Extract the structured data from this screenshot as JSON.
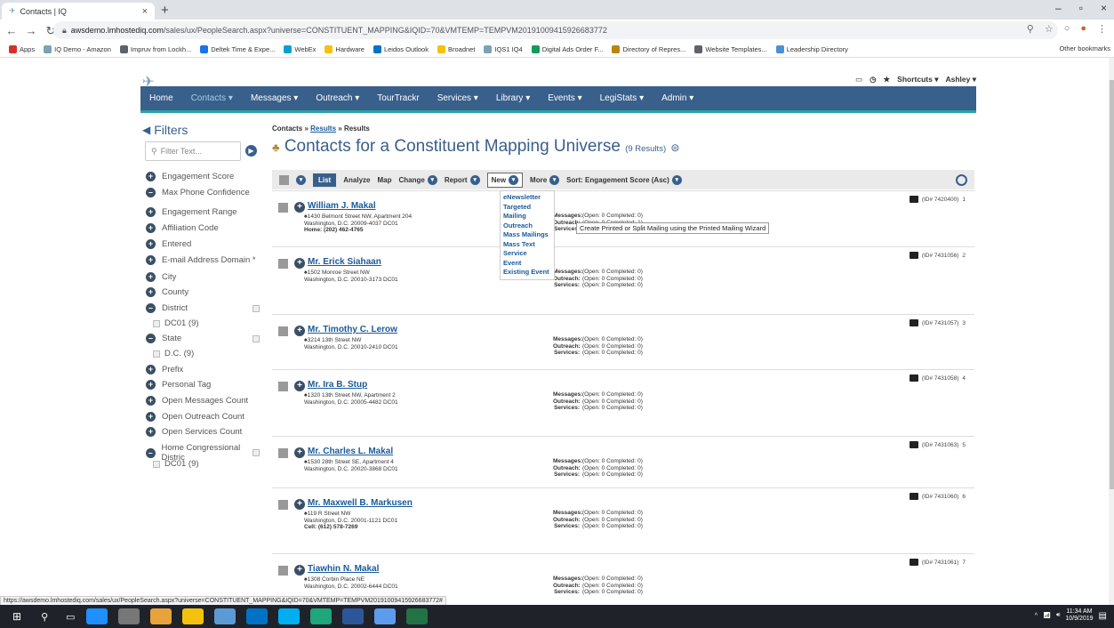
{
  "browser": {
    "tab_title": "Contacts | IQ",
    "tab_close": "×",
    "new_tab": "+",
    "url_host": "awsdemo.lmhostediq.com",
    "url_path": "/sales/ux/PeopleSearch.aspx?universe=CONSTITUENT_MAPPING&IQID=70&VMTEMP=TEMPVM20191009415926683772",
    "win_min": "–",
    "win_max": "▫",
    "win_close": "×",
    "bookmarks": [
      {
        "label": "Apps",
        "color": "#d93025"
      },
      {
        "label": "IQ Demo - Amazon",
        "color": "#7ca2b6"
      },
      {
        "label": "Impruv from Lockh...",
        "color": "#5f6368"
      },
      {
        "label": "Deltek Time & Expe...",
        "color": "#1a73e8"
      },
      {
        "label": "WebEx",
        "color": "#00a0d1"
      },
      {
        "label": "Hardware",
        "color": "#f4c20d"
      },
      {
        "label": "Leidos Outlook",
        "color": "#0072c6"
      },
      {
        "label": "Broadnet",
        "color": "#f4c20d"
      },
      {
        "label": "IQS1 IQ4",
        "color": "#7ca2b6"
      },
      {
        "label": "Digital Ads Order F...",
        "color": "#0f9d58"
      },
      {
        "label": "Directory of Repres...",
        "color": "#b8860b"
      },
      {
        "label": "Website Templates...",
        "color": "#5f6368"
      },
      {
        "label": "Leadership Directory",
        "color": "#4a90d9"
      }
    ],
    "other_bookmarks": "Other bookmarks",
    "status_url": "https://awsdemo.lmhostediq.com/sales/ux/PeopleSearch.aspx?universe=CONSTITUENT_MAPPING&IQID=70&VMTEMP=TEMPVM20191009415926683772#"
  },
  "header": {
    "shortcuts": "Shortcuts ▾",
    "user": "Ashley ▾"
  },
  "nav": [
    "Home",
    "Contacts ▾",
    "Messages ▾",
    "Outreach ▾",
    "TourTrackr",
    "Services ▾",
    "Library ▾",
    "Events ▾",
    "LegiStats ▾",
    "Admin ▾"
  ],
  "filters": {
    "title": "Filters",
    "placeholder": "Filter Text...",
    "items": [
      {
        "label": "Engagement Score",
        "type": "plus"
      },
      {
        "label": "Max Phone Confidence",
        "type": "minus"
      },
      {
        "label": "Engagement Range",
        "type": "plus"
      },
      {
        "label": "Affiliation Code",
        "type": "plus"
      },
      {
        "label": "Entered",
        "type": "plus"
      },
      {
        "label": "E-mail Address Domain *",
        "type": "plus"
      },
      {
        "label": "City",
        "type": "plus"
      },
      {
        "label": "County",
        "type": "plus"
      },
      {
        "label": "District",
        "type": "minus"
      },
      {
        "label": "DC01 (9)",
        "type": "sub"
      },
      {
        "label": "State",
        "type": "minus"
      },
      {
        "label": "D.C. (9)",
        "type": "sub"
      },
      {
        "label": "Prefix",
        "type": "plus"
      },
      {
        "label": "Personal Tag",
        "type": "plus"
      },
      {
        "label": "Open Messages Count",
        "type": "plus"
      },
      {
        "label": "Open Outreach Count",
        "type": "plus"
      },
      {
        "label": "Open Services Count",
        "type": "plus"
      },
      {
        "label": "Home Congressional Distric",
        "type": "minus"
      },
      {
        "label": "DC01 (9)",
        "type": "sub"
      }
    ]
  },
  "content": {
    "breadcrumb_a": "Contacts",
    "breadcrumb_b": "Results",
    "breadcrumb_c": "Results",
    "title": "Contacts for a Constituent Mapping Universe",
    "count": "(9 Results)",
    "toolbar": {
      "list": "List",
      "analyze": "Analyze",
      "map": "Map",
      "change": "Change",
      "report": "Report",
      "new": "New",
      "more": "More",
      "sort": "Sort: Engagement Score (Asc)"
    },
    "new_menu": [
      "eNewsletter",
      "Targeted Mailing",
      "Outreach",
      "Mass Mailings",
      "Mass Text",
      "Service",
      "Event",
      "Existing Event"
    ],
    "tooltip": "Create Printed or Split Mailing using the Printed Mailing Wizard",
    "labels": {
      "messages": "Messages:",
      "outreach": "Outreach:",
      "services": "Services:",
      "stat": "(Open: 0 Completed: 0)"
    },
    "records": [
      {
        "name": "William J. Makal",
        "addr1": "1430 Belmont Street NW, Apartment 204",
        "addr2": "Washington, D.C. 20009-4037 DC01",
        "phone": "Home: (202) 462-4765",
        "id": "(ID# 7420400)",
        "n": "1",
        "s1": "(Open: 0 Completed: 0)",
        "s2": "(Open: 0 Completed: 1)"
      },
      {
        "name": "Mr. Erick Siahaan",
        "addr1": "1502 Monroe Street NW",
        "addr2": "Washington, D.C. 20010-3173 DC01",
        "phone": "",
        "id": "(ID# 7431056)",
        "n": "2"
      },
      {
        "name": "Mr. Timothy C. Lerow",
        "addr1": "3214 13th Street NW",
        "addr2": "Washington, D.C. 20010-2410 DC01",
        "phone": "",
        "id": "(ID# 7431057)",
        "n": "3"
      },
      {
        "name": "Mr. Ira B. Stup",
        "addr1": "1320 13th Street NW, Apartment 2",
        "addr2": "Washington, D.C. 20005-4482 DC01",
        "phone": "",
        "id": "(ID# 7431058)",
        "n": "4"
      },
      {
        "name": "Mr. Charles L. Makal",
        "addr1": "1530 28th Street SE, Apartment 4",
        "addr2": "Washington, D.C. 20020-3868 DC01",
        "phone": "",
        "id": "(ID# 7431063)",
        "n": "5"
      },
      {
        "name": "Mr. Maxwell B. Markusen",
        "addr1": "119 R Street NW",
        "addr2": "Washington, D.C. 20001-1121 DC01",
        "phone": "Cell: (612) 578-7269",
        "id": "(ID# 7431060)",
        "n": "6"
      },
      {
        "name": "Tiawhin N. Makal",
        "addr1": "1308 Corbin Place NE",
        "addr2": "Washington, D.C. 20002-6444 DC01",
        "phone": "",
        "id": "(ID# 7431061)",
        "n": "7"
      }
    ]
  },
  "taskbar": {
    "time": "11:34 AM",
    "date": "10/9/2019"
  }
}
